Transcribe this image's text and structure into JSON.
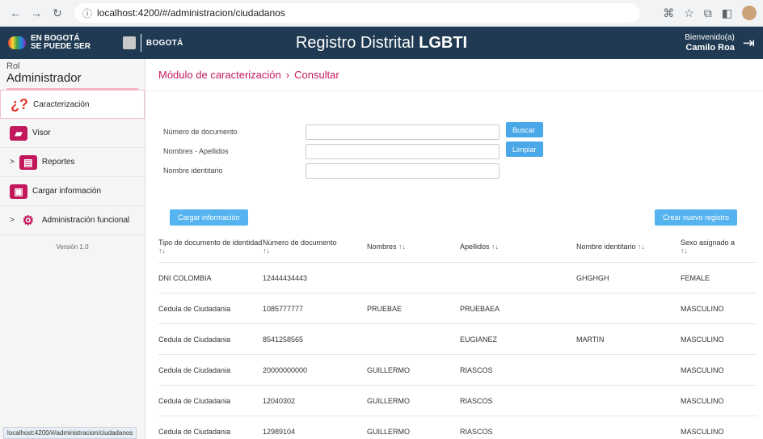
{
  "browser": {
    "url": "localhost:4200/#/administracion/ciudadanos",
    "status_url": "localhost:4200/#/administracion/ciudadanos"
  },
  "header": {
    "logo_line1": "EN BOGOTÁ",
    "logo_line2": "SE PUEDE SER",
    "bogota_logo": "BOGOTÁ",
    "title_light": "Registro Distrital",
    "title_bold": "LGBTI",
    "welcome": "Bienvenido(a)",
    "user_name": "Camilo Roa"
  },
  "sidebar": {
    "role_label": "Rol",
    "role_value": "Administrador",
    "items": [
      {
        "label": "Caracterización",
        "icon": "question-marks-icon",
        "active": true
      },
      {
        "label": "Visor",
        "icon": "map-icon"
      },
      {
        "label": "Reportes",
        "icon": "report-chart-icon"
      },
      {
        "label": "Cargar información",
        "icon": "upload-document-icon"
      },
      {
        "label": "Administración funcional",
        "icon": "gears-icon"
      }
    ],
    "version": "Versión 1.0"
  },
  "breadcrumb": {
    "module": "Módulo de caracterización",
    "page": "Consultar"
  },
  "search": {
    "doc_label": "Número de documento",
    "names_label": "Nombres - Apellidos",
    "identity_label": "Nombre identitario",
    "search_btn": "Buscar",
    "clear_btn": "Limpiar"
  },
  "toolbar": {
    "upload_btn": "Cargar información",
    "create_btn": "Crear nuevo registro"
  },
  "table": {
    "headers": [
      "Tipo de documento de identidad",
      "Número de documento",
      "Nombres",
      "Apellidos",
      "Nombre identitario",
      "Sexo asignado a"
    ],
    "sort_glyph": "↑↓",
    "rows": [
      [
        "DNI COLOMBIA",
        "12444434443",
        "",
        "",
        "GHGHGH",
        "FEMALE"
      ],
      [
        "Cedula de Ciudadania",
        "1085777777",
        "PRUEBAE",
        "PRUEBAEA",
        "",
        "MASCULINO"
      ],
      [
        "Cedula de Ciudadania",
        "8541258565",
        "",
        "EUGIANEZ",
        "MARTIN",
        "MASCULINO"
      ],
      [
        "Cedula de Ciudadania",
        "20000000000",
        "GUILLERMO",
        "RIASCOS",
        "",
        "MASCULINO"
      ],
      [
        "Cedula de Ciudadania",
        "12040302",
        "GUILLERMO",
        "RIASCOS",
        "",
        "MASCULINO"
      ],
      [
        "Cedula de Ciudadania",
        "12989104",
        "GUILLERMO",
        "RIASCOS",
        "",
        "MASCULINO"
      ]
    ]
  }
}
